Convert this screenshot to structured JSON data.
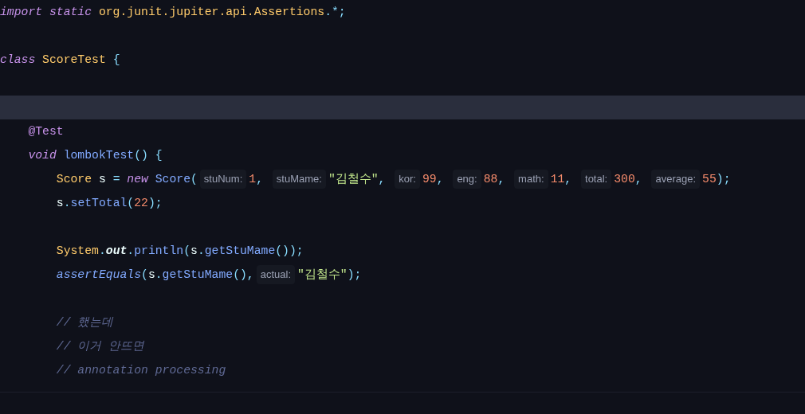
{
  "editor": {
    "lines": [
      {
        "current": false,
        "tokens": [
          {
            "kind": "keyword",
            "text": "import static "
          },
          {
            "kind": "type",
            "text": "org.junit.jupiter.api.Assertions"
          },
          {
            "kind": "punct",
            "text": ".*;"
          }
        ]
      },
      {
        "current": false
      },
      {
        "current": false,
        "tokens": [
          {
            "kind": "keyword",
            "text": "class "
          },
          {
            "kind": "type",
            "text": "ScoreTest "
          },
          {
            "kind": "punct",
            "text": "{"
          }
        ]
      },
      {
        "current": false
      },
      {
        "current": true
      },
      {
        "current": false,
        "tokens": [
          {
            "kind": "annotation",
            "text": "    @Test"
          }
        ]
      },
      {
        "current": false,
        "tokens": [
          {
            "kind": "keyword",
            "text": "    void "
          },
          {
            "kind": "method",
            "text": "lombokTest"
          },
          {
            "kind": "punct",
            "text": "() {"
          }
        ]
      },
      {
        "current": false,
        "tokens": [
          {
            "kind": "type",
            "text": "        Score "
          },
          {
            "kind": "plain",
            "text": "s "
          },
          {
            "kind": "punct",
            "text": "= "
          },
          {
            "kind": "keyword",
            "text": "new "
          },
          {
            "kind": "method",
            "text": "Score"
          },
          {
            "kind": "punct",
            "text": "("
          },
          {
            "kind": "hint",
            "text": "stuNum:"
          },
          {
            "kind": "number",
            "text": "1"
          },
          {
            "kind": "punct",
            "text": ", "
          },
          {
            "kind": "hint",
            "text": "stuMame:"
          },
          {
            "kind": "string",
            "text": "\"김철수\""
          },
          {
            "kind": "punct",
            "text": ", "
          },
          {
            "kind": "hint",
            "text": "kor:"
          },
          {
            "kind": "number",
            "text": "99"
          },
          {
            "kind": "punct",
            "text": ", "
          },
          {
            "kind": "hint",
            "text": "eng:"
          },
          {
            "kind": "number",
            "text": "88"
          },
          {
            "kind": "punct",
            "text": ", "
          },
          {
            "kind": "hint",
            "text": "math:"
          },
          {
            "kind": "number",
            "text": "11"
          },
          {
            "kind": "punct",
            "text": ", "
          },
          {
            "kind": "hint",
            "text": "total:"
          },
          {
            "kind": "number",
            "text": "300"
          },
          {
            "kind": "punct",
            "text": ", "
          },
          {
            "kind": "hint",
            "text": "average:"
          },
          {
            "kind": "number",
            "text": "55"
          },
          {
            "kind": "punct",
            "text": ");"
          }
        ]
      },
      {
        "current": false,
        "tokens": [
          {
            "kind": "plain",
            "text": "        s"
          },
          {
            "kind": "punct",
            "text": "."
          },
          {
            "kind": "method",
            "text": "setTotal"
          },
          {
            "kind": "punct",
            "text": "("
          },
          {
            "kind": "number",
            "text": "22"
          },
          {
            "kind": "punct",
            "text": ");"
          }
        ]
      },
      {
        "current": false
      },
      {
        "current": false,
        "tokens": [
          {
            "kind": "type",
            "text": "        System"
          },
          {
            "kind": "punct",
            "text": "."
          },
          {
            "kind": "field",
            "text": "out"
          },
          {
            "kind": "punct",
            "text": "."
          },
          {
            "kind": "method",
            "text": "println"
          },
          {
            "kind": "punct",
            "text": "("
          },
          {
            "kind": "plain",
            "text": "s"
          },
          {
            "kind": "punct",
            "text": "."
          },
          {
            "kind": "method",
            "text": "getStuMame"
          },
          {
            "kind": "punct",
            "text": "());"
          }
        ]
      },
      {
        "current": false,
        "tokens": [
          {
            "kind": "static",
            "text": "        assertEquals"
          },
          {
            "kind": "punct",
            "text": "("
          },
          {
            "kind": "plain",
            "text": "s"
          },
          {
            "kind": "punct",
            "text": "."
          },
          {
            "kind": "method",
            "text": "getStuMame"
          },
          {
            "kind": "punct",
            "text": "(),"
          },
          {
            "kind": "hint",
            "text": "actual:"
          },
          {
            "kind": "string",
            "text": "\"김철수\""
          },
          {
            "kind": "punct",
            "text": ");"
          }
        ]
      },
      {
        "current": false
      },
      {
        "current": false,
        "tokens": [
          {
            "kind": "comment",
            "text": "        // 했는데"
          }
        ]
      },
      {
        "current": false,
        "tokens": [
          {
            "kind": "comment",
            "text": "        // 이거 안뜨면"
          }
        ]
      },
      {
        "current": false,
        "tokens": [
          {
            "kind": "comment",
            "text": "        // annotation processing"
          }
        ]
      }
    ]
  }
}
